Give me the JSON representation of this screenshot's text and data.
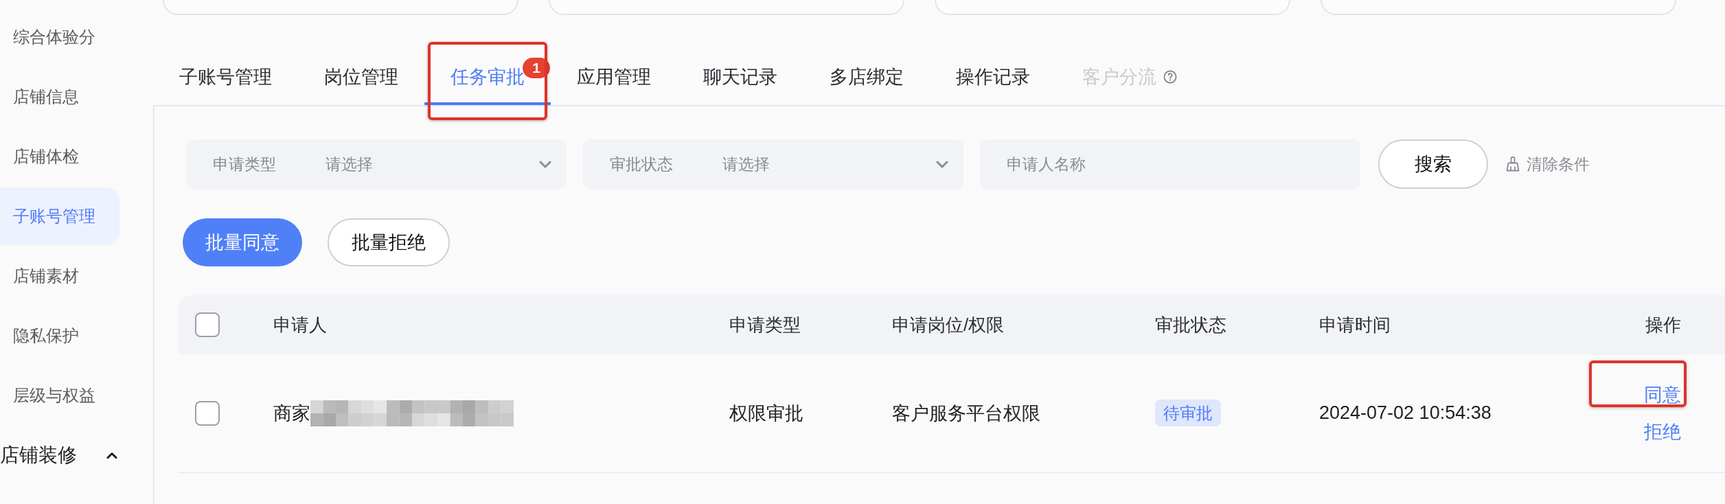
{
  "sidebar": {
    "items": [
      {
        "label": "综合体验分",
        "selected": false
      },
      {
        "label": "店铺信息",
        "selected": false
      },
      {
        "label": "店铺体检",
        "selected": false
      },
      {
        "label": "子账号管理",
        "selected": true
      },
      {
        "label": "店铺素材",
        "selected": false
      },
      {
        "label": "隐私保护",
        "selected": false
      },
      {
        "label": "层级与权益",
        "selected": false
      }
    ],
    "group": {
      "label": "店铺装修",
      "expanded": true
    }
  },
  "tabs": [
    {
      "label": "子账号管理",
      "selected": false,
      "disabled": false,
      "help": false,
      "highlighted": false
    },
    {
      "label": "岗位管理",
      "selected": false,
      "disabled": false,
      "help": false,
      "highlighted": false
    },
    {
      "label": "任务审批",
      "selected": true,
      "disabled": false,
      "help": false,
      "highlighted": true,
      "badge": "1"
    },
    {
      "label": "应用管理",
      "selected": false,
      "disabled": false,
      "help": false,
      "highlighted": false
    },
    {
      "label": "聊天记录",
      "selected": false,
      "disabled": false,
      "help": false,
      "highlighted": false
    },
    {
      "label": "多店绑定",
      "selected": false,
      "disabled": false,
      "help": false,
      "highlighted": false
    },
    {
      "label": "操作记录",
      "selected": false,
      "disabled": false,
      "help": false,
      "highlighted": false
    },
    {
      "label": "客户分流",
      "selected": false,
      "disabled": true,
      "help": true,
      "highlighted": false
    }
  ],
  "filters": [
    {
      "kind": "select",
      "label": "申请类型",
      "placeholder": "请选择"
    },
    {
      "kind": "select",
      "label": "审批状态",
      "placeholder": "请选择"
    },
    {
      "kind": "text",
      "placeholder": "申请人名称"
    }
  ],
  "search_button": "搜索",
  "clear_button": "清除条件",
  "bulk_actions": [
    {
      "kind": "primary",
      "label": "批量同意"
    },
    {
      "kind": "secondary",
      "label": "批量拒绝"
    }
  ],
  "table": {
    "all_checked": false,
    "columns": [
      "申请人",
      "申请类型",
      "申请岗位/权限",
      "审批状态",
      "申请时间",
      "操作"
    ],
    "rows": [
      {
        "checked": false,
        "applicant": "商家",
        "applicant_redacted": true,
        "type": "权限审批",
        "permission": "客户服务平台权限",
        "status": "待审批",
        "time": "2024-07-02 10:54:38",
        "actions": [
          {
            "label": "同意",
            "highlighted": true
          },
          {
            "label": "拒绝",
            "highlighted": false
          }
        ]
      }
    ]
  }
}
